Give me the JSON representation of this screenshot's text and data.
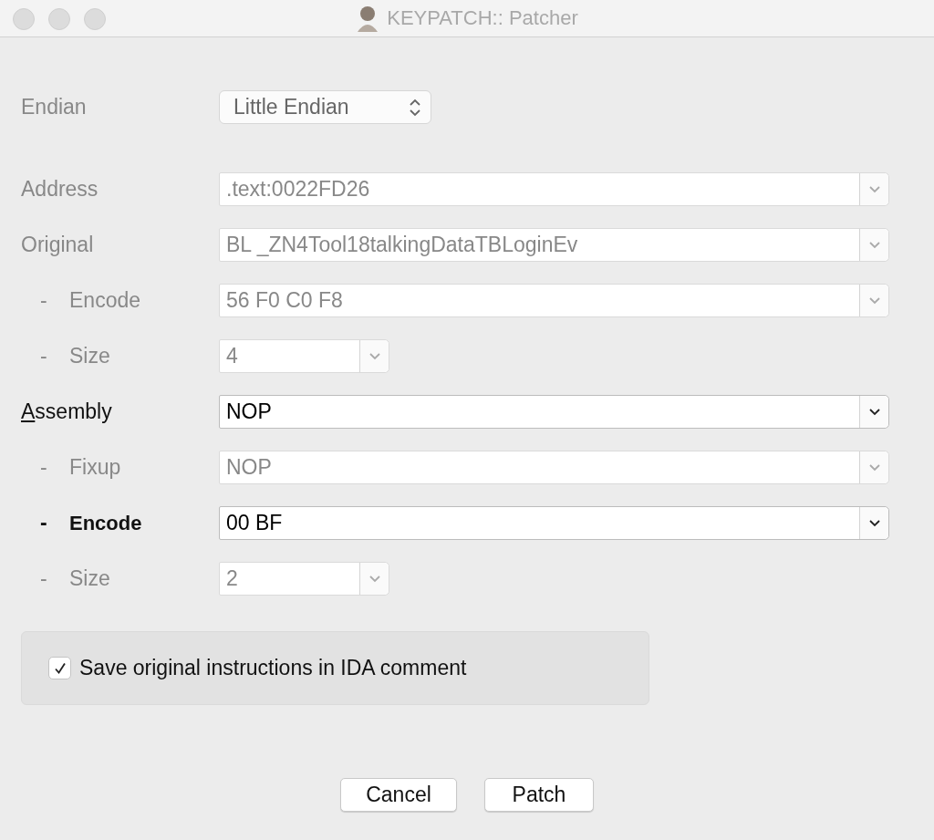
{
  "window": {
    "title": "KEYPATCH:: Patcher"
  },
  "endian": {
    "label": "Endian",
    "value": "Little Endian",
    "disabled": true
  },
  "rows": [
    {
      "label": "Address",
      "value": ".text:0022FD26",
      "enabled": false,
      "accelerator": false,
      "kind": "wide"
    },
    {
      "label": "Original",
      "value": "BL _ZN4Tool18talkingDataTBLoginEv",
      "enabled": false,
      "accelerator": false,
      "kind": "wide",
      "children": [
        {
          "prefix": "-",
          "label": "Encode",
          "value": "56 F0 C0 F8",
          "enabled": false,
          "kind": "wide"
        },
        {
          "prefix": "-",
          "label": "Size",
          "value": "4",
          "enabled": false,
          "kind": "narrow"
        }
      ]
    },
    {
      "label": "Assembly",
      "value": "NOP",
      "enabled": true,
      "accelerator": true,
      "kind": "wide",
      "children": [
        {
          "prefix": "-",
          "label": "Fixup",
          "value": "NOP",
          "enabled": false,
          "kind": "wide"
        },
        {
          "prefix": "-",
          "label": "Encode",
          "value": "00 BF",
          "enabled": true,
          "kind": "wide"
        },
        {
          "prefix": "-",
          "label": "Size",
          "value": "2",
          "enabled": false,
          "kind": "narrow"
        }
      ]
    }
  ],
  "option": {
    "label": "Save original instructions in IDA comment",
    "checked": true
  },
  "buttons": [
    "Cancel",
    "Patch"
  ]
}
